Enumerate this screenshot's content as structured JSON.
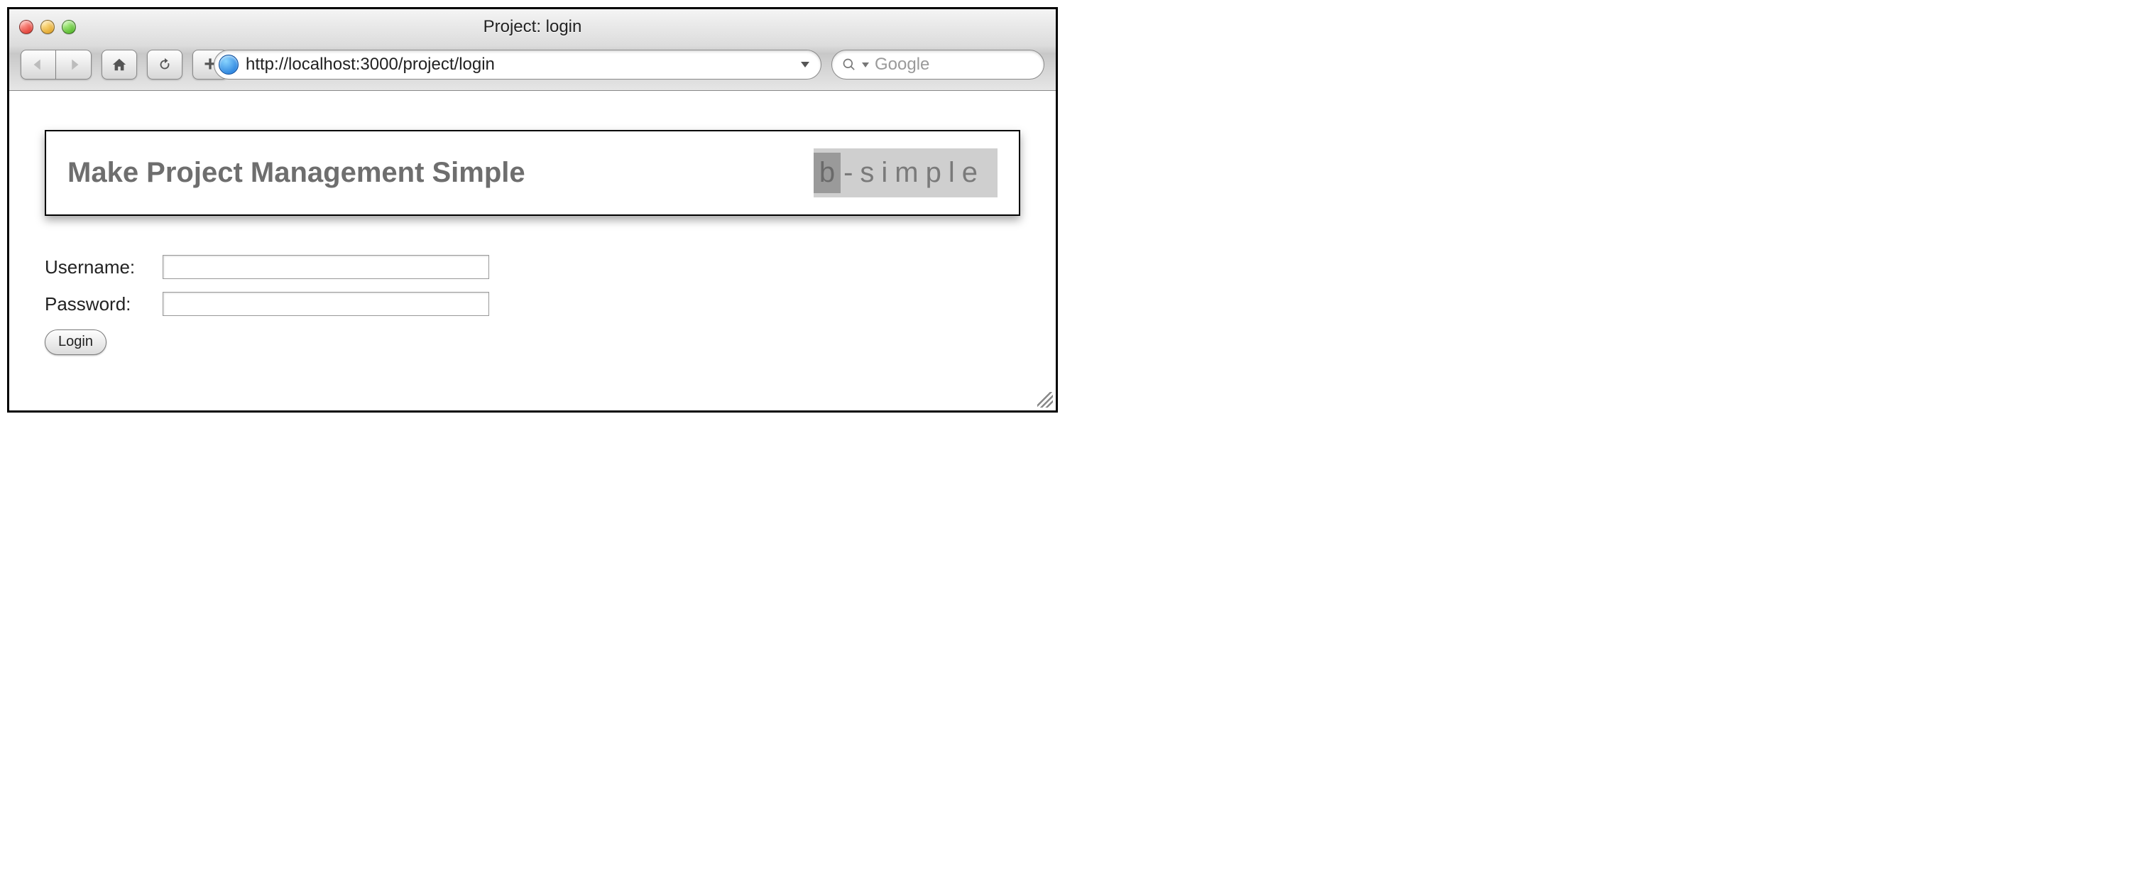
{
  "window": {
    "title": "Project: login"
  },
  "toolbar": {
    "url": "http://localhost:3000/project/login",
    "search_placeholder": "Google"
  },
  "page": {
    "banner_title": "Make Project Management Simple",
    "logo_b": "b",
    "logo_rest": "-simple"
  },
  "form": {
    "username_label": "Username:",
    "password_label": "Password:",
    "username_value": "",
    "password_value": "",
    "submit_label": "Login"
  }
}
